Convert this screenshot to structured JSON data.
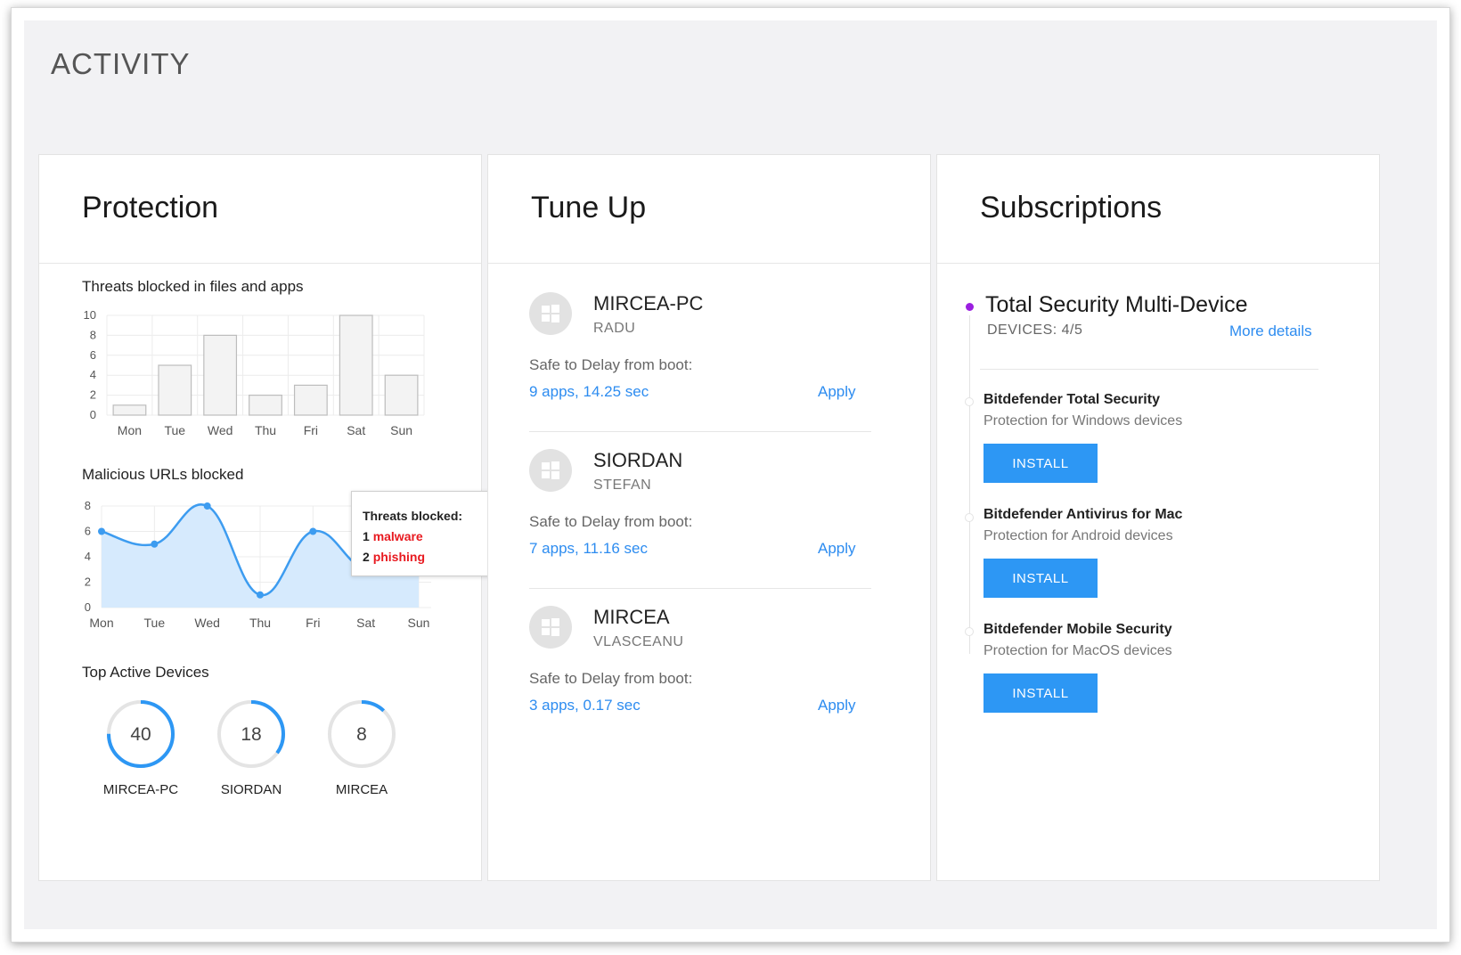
{
  "activity_title": "ACTIVITY",
  "protection": {
    "title": "Protection",
    "threats_label": "Threats blocked in files and apps",
    "urls_label": "Malicious URLs blocked",
    "top_devices_label": "Top Active Devices",
    "tooltip": {
      "title": "Threats blocked:",
      "malware_count": "1",
      "malware_label": "malware",
      "phishing_count": "2",
      "phishing_label": "phishing"
    },
    "top_devices": [
      {
        "value": "40",
        "name": "MIRCEA-PC",
        "fraction": 0.75
      },
      {
        "value": "18",
        "name": "SIORDAN",
        "fraction": 0.35
      },
      {
        "value": "8",
        "name": "MIRCEA",
        "fraction": 0.12
      }
    ],
    "ring_color": "#2d97f4"
  },
  "chart_data": [
    {
      "type": "bar",
      "categories": [
        "Mon",
        "Tue",
        "Wed",
        "Thu",
        "Fri",
        "Sat",
        "Sun"
      ],
      "values": [
        1,
        5,
        8,
        2,
        3,
        10,
        4
      ],
      "yticks": [
        0,
        2,
        4,
        6,
        8,
        10
      ],
      "ylim": [
        0,
        10
      ],
      "grid": true
    },
    {
      "type": "area",
      "categories": [
        "Mon",
        "Tue",
        "Wed",
        "Thu",
        "Fri",
        "Sat",
        "Sun"
      ],
      "values": [
        6,
        5,
        8,
        1,
        6,
        3,
        4
      ],
      "yticks": [
        0,
        2,
        4,
        6,
        8
      ],
      "ylim": [
        0,
        8
      ],
      "grid": true,
      "color": "#3d9cf0",
      "fill": "#d6eafd"
    }
  ],
  "tuneup": {
    "title": "Tune Up",
    "devices": [
      {
        "name": "MIRCEA-PC",
        "user": "RADU",
        "delay_label": "Safe to Delay from boot:",
        "delay_value": "9 apps, 14.25 sec",
        "apply": "Apply"
      },
      {
        "name": "SIORDAN",
        "user": "STEFAN",
        "delay_label": "Safe to Delay from boot:",
        "delay_value": "7 apps, 11.16 sec",
        "apply": "Apply"
      },
      {
        "name": "MIRCEA",
        "user": "VLASCEANU",
        "delay_label": "Safe to Delay from boot:",
        "delay_value": "3 apps, 0.17 sec",
        "apply": "Apply"
      }
    ]
  },
  "subscriptions": {
    "title": "Subscriptions",
    "plan_name": "Total Security Multi-Device",
    "plan_devices": "DEVICES: 4/5",
    "more_details": "More details",
    "products": [
      {
        "name": "Bitdefender Total Security",
        "desc": "Protection for Windows devices",
        "button": "INSTALL"
      },
      {
        "name": "Bitdefender Antivirus for Mac",
        "desc": "Protection for Android devices",
        "button": "INSTALL"
      },
      {
        "name": "Bitdefender Mobile Security",
        "desc": "Protection for MacOS devices",
        "button": "INSTALL"
      }
    ]
  }
}
